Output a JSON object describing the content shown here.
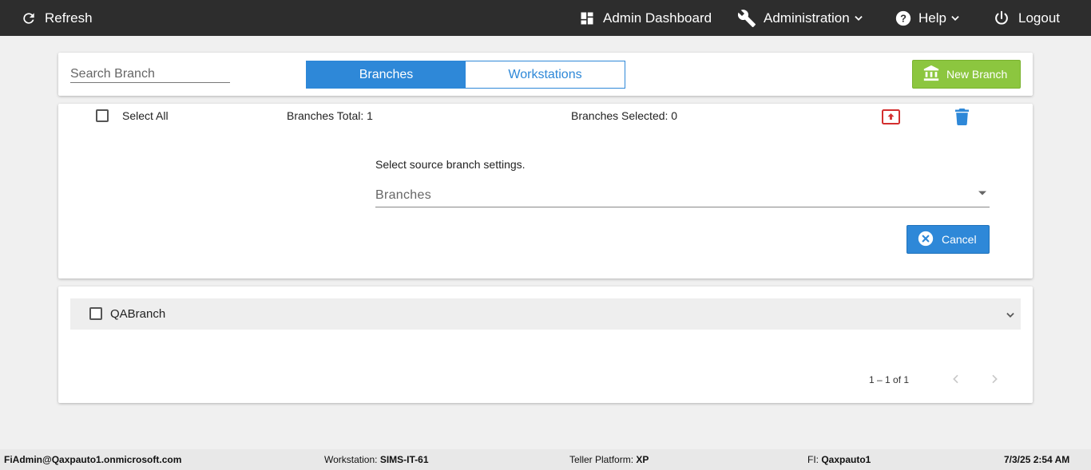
{
  "topbar": {
    "refresh_label": "Refresh",
    "admin_dashboard_label": "Admin Dashboard",
    "administration_label": "Administration",
    "help_label": "Help",
    "logout_label": "Logout",
    "icons": [
      "refresh-icon",
      "dashboard-icon",
      "wrench-icon",
      "help-icon",
      "power-icon",
      "chevron-down-icon"
    ]
  },
  "toolbar": {
    "search_placeholder": "Search Branch",
    "search_value": "",
    "tabs": [
      {
        "label": "Branches",
        "active": true
      },
      {
        "label": "Workstations",
        "active": false
      }
    ],
    "new_branch_label": "New Branch"
  },
  "bulk": {
    "select_all_label": "Select All",
    "select_all_checked": false,
    "total_text": "Branches Total: 1",
    "selected_text": "Branches Selected: 0"
  },
  "source": {
    "prompt": "Select source branch settings.",
    "select_placeholder": "Branches",
    "cancel_label": "Cancel"
  },
  "branches": [
    {
      "name": "QABranch",
      "checked": false
    }
  ],
  "pagination": {
    "range_text": "1 – 1 of 1"
  },
  "footer": {
    "user": "FiAdmin@Qaxpauto1.onmicrosoft.com",
    "workstation_label": "Workstation:",
    "workstation_value": "SIMS-IT-61",
    "platform_label": "Teller Platform:",
    "platform_value": "XP",
    "fi_label": "FI:",
    "fi_value": "Qaxpauto1",
    "datetime": "7/3/25 2:54 AM"
  },
  "colors": {
    "topbar_bg": "#2d2d2d",
    "primary_blue": "#2e88d8",
    "new_branch_green": "#8cc63f",
    "upload_red": "#d32f2f",
    "page_bg": "#f0f0f0"
  }
}
